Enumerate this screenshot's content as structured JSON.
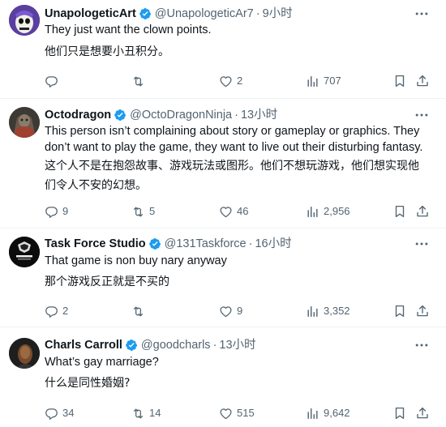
{
  "tweets": [
    {
      "name": "UnapologeticArt",
      "handle": "@UnapologeticAr7",
      "time": "9小时",
      "text_en": "They just want the clown points.",
      "text_zh": "他们只是想要小丑积分。",
      "replies": "",
      "retweets": "",
      "likes": "2",
      "views": "707"
    },
    {
      "name": "Octodragon",
      "handle": "@OctoDragonNinja",
      "time": "13小时",
      "text_en": "This person isn’t complaining about story or gameplay or graphics. They don’t want to play the game, they want to live out their disturbing fantasy.",
      "text_zh": "这个人不是在抱怨故事、游戏玩法或图形。他们不想玩游戏，他们想实现他们令人不安的幻想。",
      "replies": "9",
      "retweets": "5",
      "likes": "46",
      "views": "2,956"
    },
    {
      "name": "Task Force Studio",
      "handle": "@131Taskforce",
      "time": "16小时",
      "text_en": "That game is non buy nary anyway",
      "text_zh": "那个游戏反正就是不买的",
      "replies": "2",
      "retweets": "",
      "likes": "9",
      "views": "3,352"
    },
    {
      "name": "Charls Carroll",
      "handle": "@goodcharls",
      "time": "13小时",
      "text_en": "What’s gay marriage?",
      "text_zh": "什么是同性婚姻?",
      "replies": "34",
      "retweets": "14",
      "likes": "515",
      "views": "9,642"
    }
  ],
  "colors": {
    "verified": "#1d9bf0",
    "secondary_text": "#536471",
    "divider": "#eff3f4"
  },
  "icons": [
    "verified-badge-icon",
    "more-icon",
    "reply-icon",
    "retweet-icon",
    "like-icon",
    "views-icon",
    "bookmark-icon",
    "share-icon"
  ]
}
